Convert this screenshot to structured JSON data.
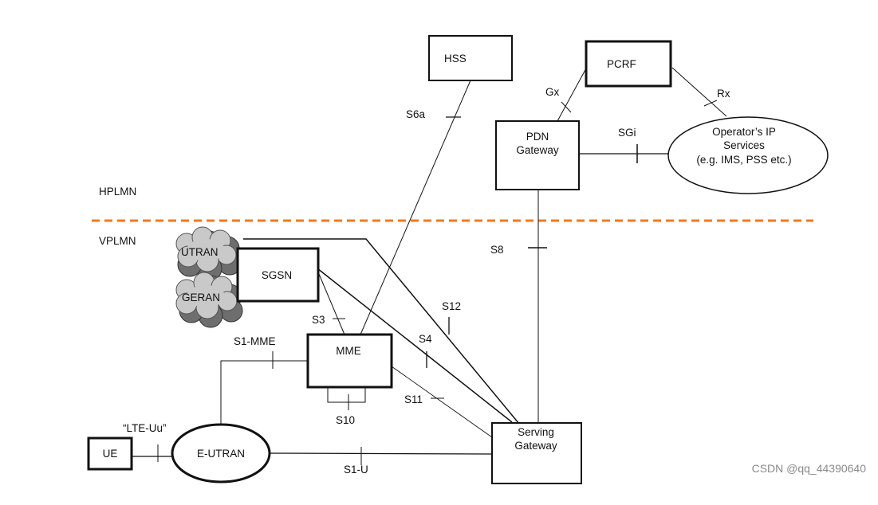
{
  "nodes": {
    "hss": "HSS",
    "pcrf": "PCRF",
    "pdn_gateway": [
      "PDN",
      "Gateway"
    ],
    "operator_ip_services": [
      "Operator’s IP",
      "Services",
      "(e.g. IMS, PSS etc.)"
    ],
    "utran": "UTRAN",
    "geran": "GERAN",
    "sgsn": "SGSN",
    "mme": "MME",
    "serving_gateway": [
      "Serving",
      "Gateway"
    ],
    "e_utran": "E-UTRAN",
    "ue": "UE"
  },
  "regions": {
    "home": "HPLMN",
    "visited": "VPLMN",
    "boundary_color": "#f07a22"
  },
  "interfaces": {
    "s6a": "S6a",
    "gx": "Gx",
    "rx": "Rx",
    "sgi": "SGi",
    "s8": "S8",
    "s12": "S12",
    "s4": "S4",
    "s3": "S3",
    "s1_mme": "S1-MME",
    "s10": "S10",
    "s11": "S11",
    "lte_uu": "“LTE-Uu”",
    "s1_u": "S1-U"
  },
  "watermark": "CSDN @qq_44390640"
}
